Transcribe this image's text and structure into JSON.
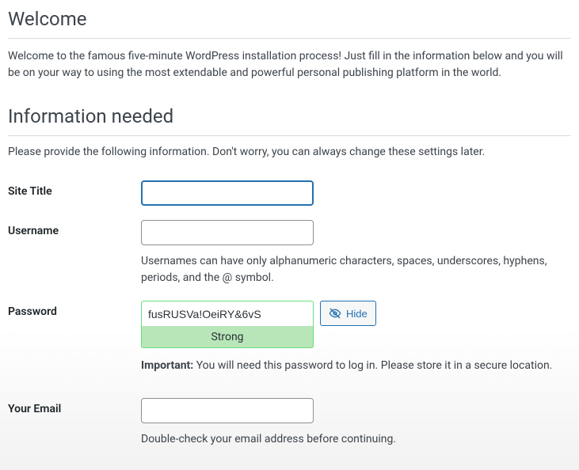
{
  "welcome": {
    "heading": "Welcome",
    "intro": "Welcome to the famous five-minute WordPress installation process! Just fill in the information below and you will be on your way to using the most extendable and powerful personal publishing platform in the world."
  },
  "info_section": {
    "heading": "Information needed",
    "hint": "Please provide the following information. Don't worry, you can always change these settings later."
  },
  "fields": {
    "site_title": {
      "label": "Site Title",
      "value": ""
    },
    "username": {
      "label": "Username",
      "value": "",
      "help": "Usernames can have only alphanumeric characters, spaces, underscores, hyphens, periods, and the @ symbol."
    },
    "password": {
      "label": "Password",
      "value": "fusRUSVa!OeiRY&6vS",
      "strength_label": "Strong",
      "hide_button": "Hide",
      "important_prefix": "Important:",
      "important_text": " You will need this password to log in. Please store it in a secure location."
    },
    "email": {
      "label": "Your Email",
      "value": "",
      "help": "Double-check your email address before continuing."
    }
  }
}
